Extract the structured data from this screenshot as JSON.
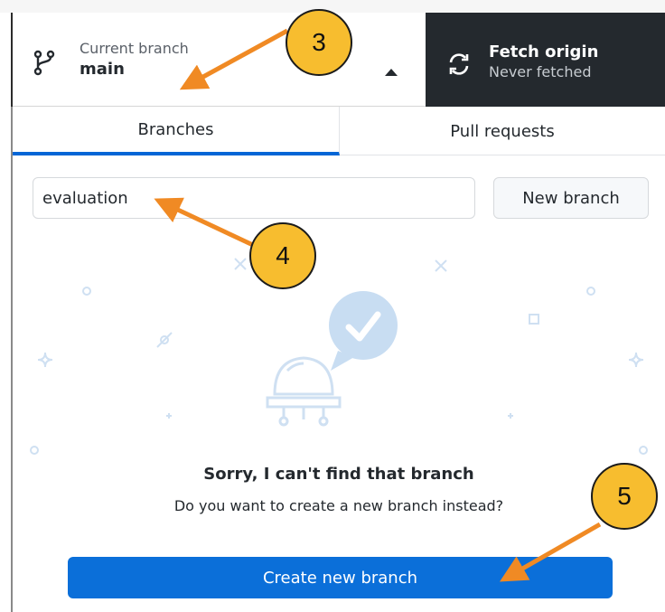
{
  "toolbar": {
    "current_branch_caption": "Current branch",
    "current_branch_name": "main",
    "fetch_title": "Fetch origin",
    "fetch_subtitle": "Never fetched"
  },
  "tabs": [
    {
      "label": "Branches",
      "active": true
    },
    {
      "label": "Pull requests",
      "active": false
    }
  ],
  "filter": {
    "value": "evaluation"
  },
  "new_branch_label": "New branch",
  "empty_state": {
    "title": "Sorry, I can't find that branch",
    "subtitle": "Do you want to create a new branch instead?"
  },
  "create_button_label": "Create new branch",
  "annotations": [
    {
      "number": "3"
    },
    {
      "number": "4"
    },
    {
      "number": "5"
    }
  ],
  "colors": {
    "accent": "#0b6fd9",
    "dark_toolbar": "#24292e",
    "annotation_badge": "#f7bd2f",
    "annotation_arrow": "#f08a24"
  }
}
